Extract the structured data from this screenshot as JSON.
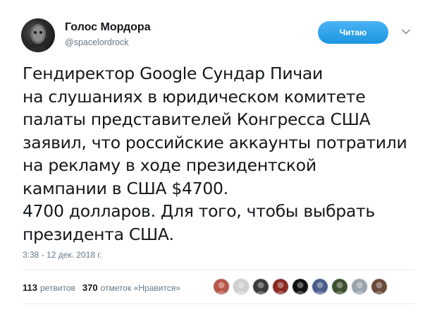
{
  "author": {
    "display_name": "Голос Мордора",
    "handle": "@spacelordrock",
    "avatar_icon": "avatar-dark-face"
  },
  "follow_button": {
    "label": "Читаю",
    "color": "#1da1f2"
  },
  "caret_icon": "chevron-down-icon",
  "tweet": {
    "lines": [
      "Гендиректор Google Сундар Пичаи",
      "на слушаниях в юридическом комитете",
      "палаты представителей Конгресса США",
      "заявил, что российские аккаунты потратили",
      "на рекламу в ходе президентской",
      "кампании в США $4700.",
      "4700 долларов. Для того, чтобы выбрать",
      "президента США."
    ],
    "timestamp": "3:38 - 12 дек. 2018 г."
  },
  "stats": {
    "retweets_count": "113",
    "retweets_label": "ретвитов",
    "likes_count": "370",
    "likes_label": "отметок «Нравится»"
  },
  "likers": [
    {
      "name": "liker-avatar-1",
      "color": "#b7564a"
    },
    {
      "name": "liker-avatar-2",
      "color": "#cfcfcf"
    },
    {
      "name": "liker-avatar-3",
      "color": "#3b3b3b"
    },
    {
      "name": "liker-avatar-4",
      "color": "#8a2a22"
    },
    {
      "name": "liker-avatar-5",
      "color": "#111111"
    },
    {
      "name": "liker-avatar-6",
      "color": "#4a5c8a"
    },
    {
      "name": "liker-avatar-7",
      "color": "#3d4f2f"
    },
    {
      "name": "liker-avatar-8",
      "color": "#9aa4ad"
    },
    {
      "name": "liker-avatar-9",
      "color": "#6b4a3a"
    }
  ]
}
